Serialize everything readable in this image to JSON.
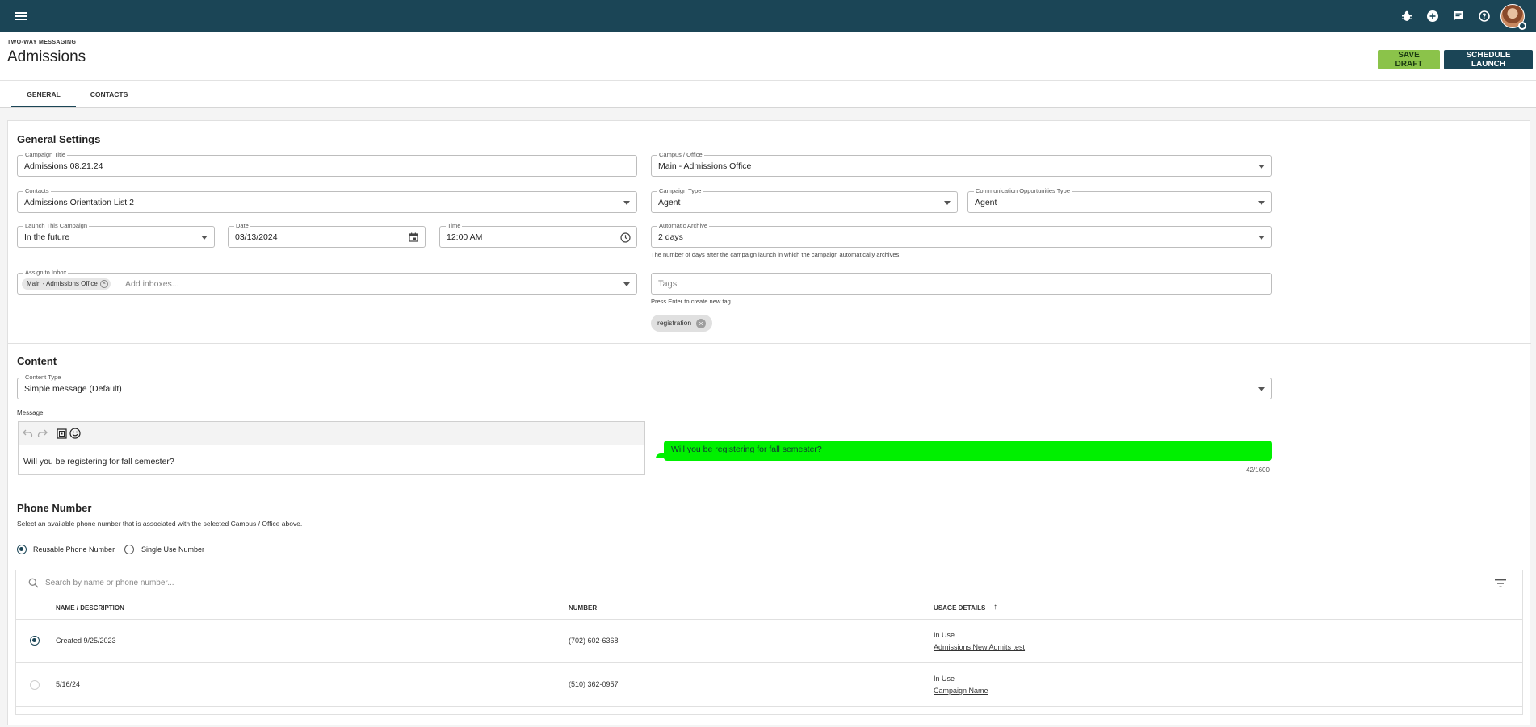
{
  "topbar": {
    "menu_icon": "hamburger-icon",
    "icons": [
      "bug-icon",
      "add-circle-icon",
      "chat-icon",
      "help-icon"
    ]
  },
  "header": {
    "eyebrow": "TWO-WAY MESSAGING",
    "title": "Admissions",
    "save_draft": "SAVE DRAFT",
    "schedule_launch": "SCHEDULE LAUNCH"
  },
  "tabs": [
    {
      "label": "GENERAL",
      "active": true
    },
    {
      "label": "CONTACTS",
      "active": false
    }
  ],
  "general": {
    "heading": "General Settings",
    "campaign_title": {
      "label": "Campaign Title",
      "value": "Admissions 08.21.24"
    },
    "campus": {
      "label": "Campus / Office",
      "value": "Main - Admissions Office"
    },
    "contacts": {
      "label": "Contacts",
      "value": "Admissions Orientation List 2"
    },
    "campaign_type": {
      "label": "Campaign Type",
      "value": "Agent"
    },
    "comm_type": {
      "label": "Communication Opportunities Type",
      "value": "Agent"
    },
    "launch": {
      "label": "Launch This Campaign",
      "value": "In the future"
    },
    "date": {
      "label": "Date",
      "value": "03/13/2024"
    },
    "time": {
      "label": "Time",
      "value": "12:00 AM"
    },
    "archive": {
      "label": "Automatic Archive",
      "value": "2 days",
      "helper": "The number of days after the campaign launch in which the campaign automatically archives."
    },
    "inbox": {
      "label": "Assign to Inbox",
      "chip": "Main - Admissions Office",
      "placeholder": "Add inboxes..."
    },
    "tags": {
      "placeholder": "Tags",
      "helper": "Press Enter to create new tag",
      "chips": [
        "registration"
      ]
    }
  },
  "content": {
    "heading": "Content",
    "content_type": {
      "label": "Content Type",
      "value": "Simple message (Default)"
    },
    "message_label": "Message",
    "message": "Will you be registering for fall semester?",
    "preview": "Will you be registering for fall semester?",
    "counter": "42/1600"
  },
  "phone": {
    "heading": "Phone Number",
    "description": "Select an available phone number that is associated with the selected Campus / Office above.",
    "option_reusable": "Reusable Phone Number",
    "option_single": "Single Use Number",
    "selected_option": "reusable",
    "search_placeholder": "Search by name or phone number...",
    "columns": [
      "NAME / DESCRIPTION",
      "NUMBER",
      "USAGE DETAILS"
    ],
    "sort_indicator": "↑",
    "rows": [
      {
        "name": "Created 9/25/2023",
        "number": "(702) 602-6368",
        "status": "In Use",
        "usage": "Admissions New Admits test",
        "selected": true
      },
      {
        "name": "5/16/24",
        "number": "(510) 362-0957",
        "status": "In Use",
        "usage": "Campaign Name",
        "selected": false
      }
    ]
  },
  "colors": {
    "brand": "#1b4556",
    "draft_button": "#8bc34a",
    "preview_bubble": "#00f000"
  }
}
